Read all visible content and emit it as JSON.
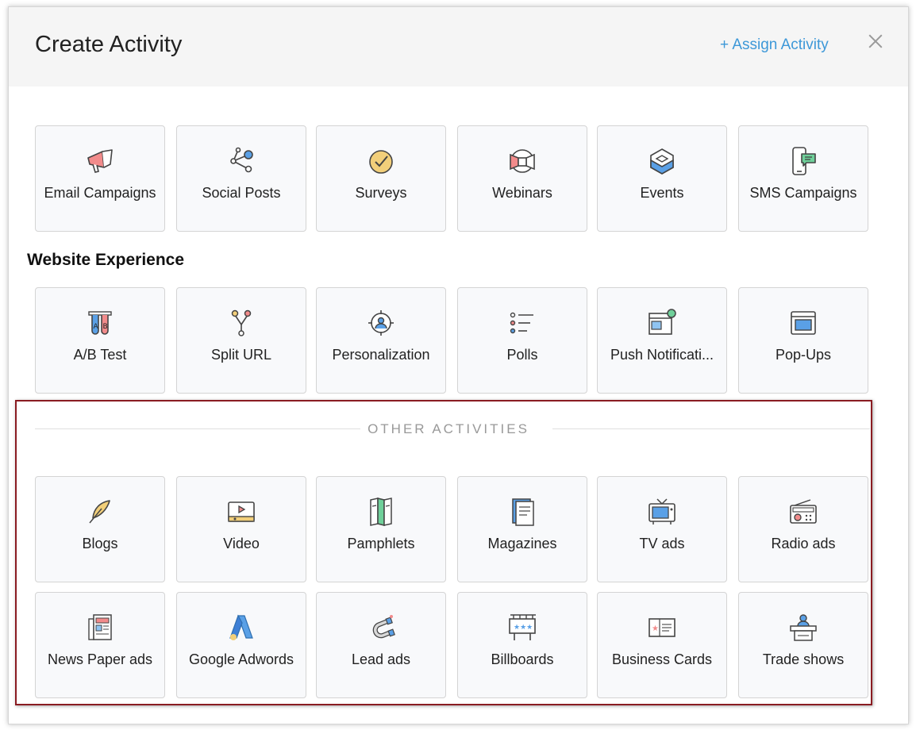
{
  "dialog": {
    "title": "Create Activity",
    "assign_label": "+ Assign Activity"
  },
  "primary": [
    {
      "label": "Email Campaigns",
      "icon": "megaphone-icon"
    },
    {
      "label": "Social Posts",
      "icon": "share-icon"
    },
    {
      "label": "Surveys",
      "icon": "check-circle-icon"
    },
    {
      "label": "Webinars",
      "icon": "webinar-icon"
    },
    {
      "label": "Events",
      "icon": "cube-icon"
    },
    {
      "label": "SMS Campaigns",
      "icon": "phone-chat-icon"
    }
  ],
  "website": {
    "title": "Website Experience",
    "items": [
      {
        "label": "A/B Test",
        "icon": "test-tubes-icon"
      },
      {
        "label": "Split URL",
        "icon": "split-icon"
      },
      {
        "label": "Personalization",
        "icon": "target-user-icon"
      },
      {
        "label": "Polls",
        "icon": "list-icon"
      },
      {
        "label": "Push Notificati...",
        "icon": "notification-window-icon"
      },
      {
        "label": "Pop-Ups",
        "icon": "popup-window-icon"
      }
    ]
  },
  "other": {
    "title": "OTHER ACTIVITIES",
    "row1": [
      {
        "label": "Blogs",
        "icon": "quill-icon"
      },
      {
        "label": "Video",
        "icon": "video-player-icon"
      },
      {
        "label": "Pamphlets",
        "icon": "pamphlet-icon"
      },
      {
        "label": "Magazines",
        "icon": "magazine-icon"
      },
      {
        "label": "TV ads",
        "icon": "tv-icon"
      },
      {
        "label": "Radio ads",
        "icon": "radio-icon"
      }
    ],
    "row2": [
      {
        "label": "News Paper ads",
        "icon": "newspaper-icon"
      },
      {
        "label": "Google Adwords",
        "icon": "adwords-icon"
      },
      {
        "label": "Lead ads",
        "icon": "magnet-icon"
      },
      {
        "label": "Billboards",
        "icon": "billboard-icon"
      },
      {
        "label": "Business Cards",
        "icon": "business-card-icon"
      },
      {
        "label": "Trade shows",
        "icon": "podium-icon"
      }
    ]
  },
  "colors": {
    "accent": "#3d98d8",
    "highlight_border": "#8a1c22"
  }
}
